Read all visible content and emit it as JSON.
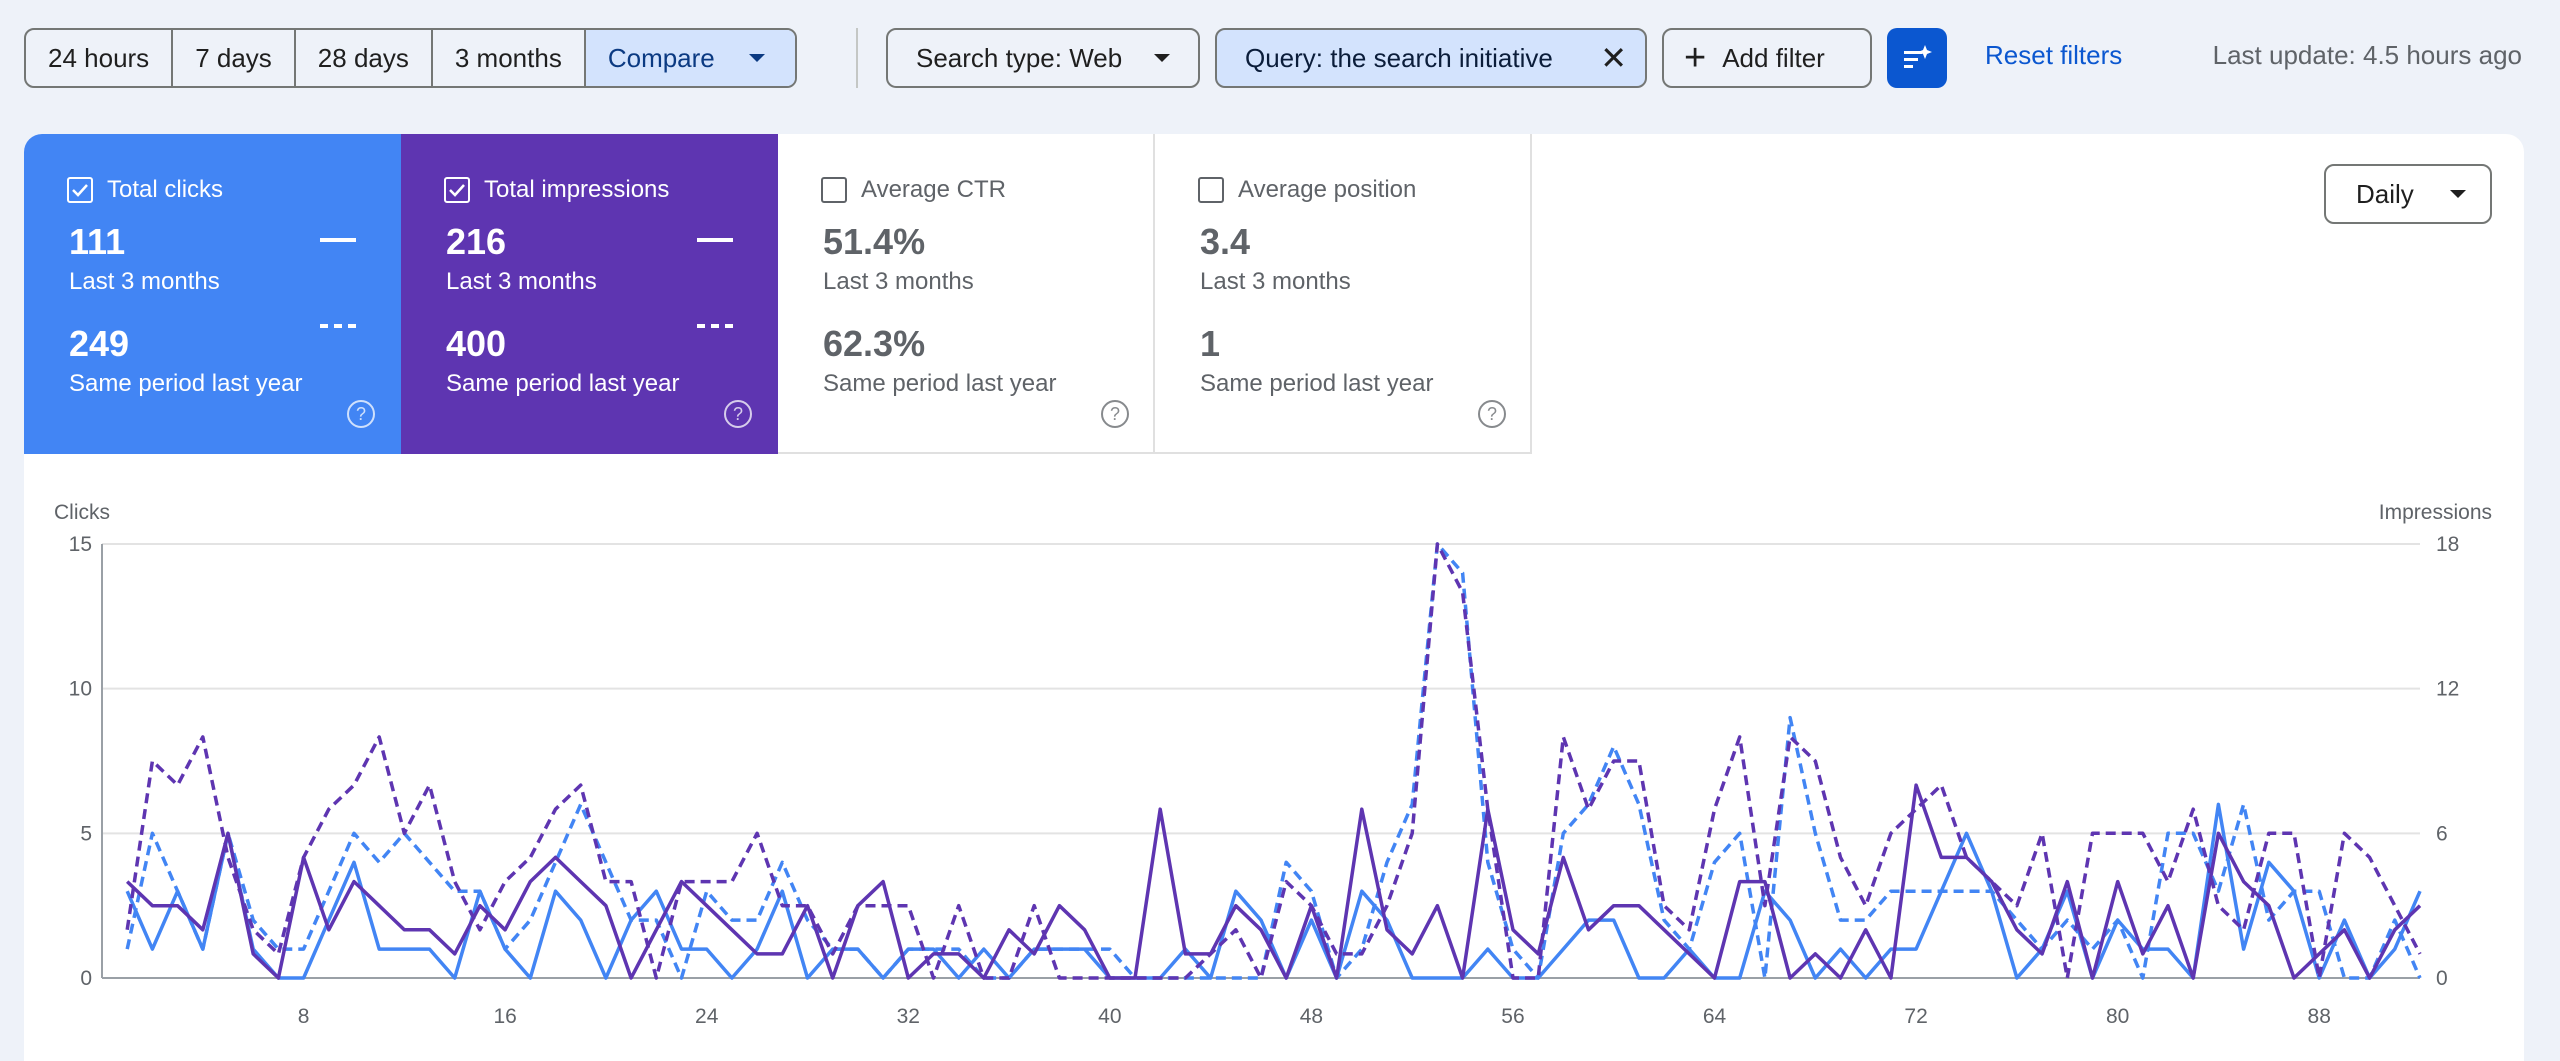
{
  "toolbar": {
    "ranges": [
      "24 hours",
      "7 days",
      "28 days",
      "3 months"
    ],
    "compare_label": "Compare",
    "search_type_label": "Search type: Web",
    "query_label": "Query: the search initiative",
    "add_filter_label": "Add filter",
    "reset_label": "Reset filters",
    "last_update": "Last update: 4.5 hours ago"
  },
  "metrics": {
    "clicks": {
      "label": "Total clicks",
      "value": "111",
      "period": "Last 3 months",
      "compare_value": "249",
      "compare_period": "Same period last year",
      "checked": true,
      "color": "#4285f4"
    },
    "impressions": {
      "label": "Total impressions",
      "value": "216",
      "period": "Last 3 months",
      "compare_value": "400",
      "compare_period": "Same period last year",
      "checked": true,
      "color": "#5e35b1"
    },
    "ctr": {
      "label": "Average CTR",
      "value": "51.4%",
      "period": "Last 3 months",
      "compare_value": "62.3%",
      "compare_period": "Same period last year",
      "checked": false
    },
    "position": {
      "label": "Average position",
      "value": "3.4",
      "period": "Last 3 months",
      "compare_value": "1",
      "compare_period": "Same period last year",
      "checked": false
    }
  },
  "granularity": "Daily",
  "help_glyph": "?",
  "chart_data": {
    "type": "line",
    "left_axis_label": "Clicks",
    "right_axis_label": "Impressions",
    "left_ylim": [
      0,
      15
    ],
    "right_ylim": [
      0,
      18
    ],
    "left_ticks": [
      "0",
      "5",
      "10",
      "15"
    ],
    "right_ticks": [
      "0",
      "6",
      "12",
      "18"
    ],
    "x_ticks": [
      "8",
      "16",
      "24",
      "32",
      "40",
      "48",
      "56",
      "64",
      "72",
      "80",
      "88"
    ],
    "x_range": [
      0,
      92
    ],
    "grid": true,
    "series": [
      {
        "axis": "left",
        "style": "solid",
        "color": "#4285f4",
        "values": [
          3,
          1,
          3,
          1,
          5,
          1,
          0,
          0,
          2,
          4,
          1,
          1,
          1,
          0,
          3,
          1,
          0,
          3,
          2,
          0,
          2,
          3,
          1,
          1,
          0,
          1,
          3,
          0,
          1,
          1,
          0,
          1,
          1,
          0,
          1,
          0,
          1,
          1,
          1,
          0,
          0,
          0,
          1,
          0,
          3,
          2,
          0,
          2,
          0,
          3,
          2,
          0,
          0,
          0,
          1,
          0,
          0,
          1,
          2,
          2,
          0,
          0,
          1,
          0,
          0,
          3,
          2,
          0,
          1,
          0,
          1,
          1,
          3,
          5,
          3,
          0,
          1,
          3,
          0,
          2,
          1,
          1,
          0,
          6,
          1,
          4,
          3,
          0,
          2,
          0,
          1,
          3
        ]
      },
      {
        "axis": "left",
        "style": "dashed",
        "color": "#4285f4",
        "values": [
          1,
          5,
          3,
          1,
          5,
          2,
          1,
          1,
          3,
          5,
          4,
          5,
          4,
          3,
          3,
          1,
          2,
          4,
          6,
          4,
          2,
          2,
          0,
          3,
          2,
          2,
          4,
          2,
          1,
          1,
          0,
          1,
          1,
          1,
          0,
          0,
          1,
          1,
          1,
          1,
          0,
          0,
          0,
          0,
          0,
          0,
          4,
          3,
          0,
          1,
          4,
          6,
          15,
          14,
          4,
          1,
          0,
          5,
          6,
          8,
          6,
          2,
          1,
          4,
          5,
          0,
          9,
          5,
          2,
          2,
          3,
          3,
          3,
          3,
          3,
          2,
          1,
          2,
          1,
          2,
          0,
          5,
          5,
          3,
          6,
          2,
          3,
          3,
          0,
          0,
          2,
          0
        ]
      },
      {
        "axis": "right",
        "style": "solid",
        "color": "#5e35b1",
        "values": [
          4,
          3,
          3,
          2,
          6,
          1,
          0,
          5,
          2,
          4,
          3,
          2,
          2,
          1,
          3,
          2,
          4,
          5,
          4,
          3,
          0,
          2,
          4,
          3,
          2,
          1,
          1,
          3,
          0,
          3,
          4,
          0,
          1,
          1,
          0,
          2,
          1,
          3,
          2,
          0,
          0,
          7,
          1,
          1,
          3,
          2,
          0,
          3,
          0,
          7,
          2,
          1,
          3,
          0,
          7,
          2,
          1,
          5,
          2,
          3,
          3,
          2,
          1,
          0,
          4,
          4,
          0,
          1,
          0,
          2,
          0,
          8,
          5,
          5,
          4,
          2,
          1,
          4,
          0,
          4,
          1,
          3,
          0,
          6,
          4,
          3,
          0,
          1,
          2,
          0,
          2,
          3
        ]
      },
      {
        "axis": "right",
        "style": "dashed",
        "color": "#5e35b1",
        "values": [
          2,
          9,
          8,
          10,
          5,
          2,
          1,
          5,
          7,
          8,
          10,
          6,
          8,
          4,
          2,
          4,
          5,
          7,
          8,
          4,
          4,
          0,
          4,
          4,
          4,
          6,
          3,
          3,
          1,
          3,
          3,
          3,
          0,
          3,
          0,
          0,
          3,
          0,
          0,
          0,
          0,
          0,
          0,
          1,
          2,
          0,
          4,
          3,
          1,
          1,
          3,
          6,
          18,
          16,
          7,
          0,
          0,
          10,
          7,
          9,
          9,
          3,
          2,
          7,
          10,
          3,
          10,
          9,
          5,
          3,
          6,
          7,
          8,
          5,
          4,
          3,
          6,
          0,
          6,
          6,
          6,
          4,
          7,
          3,
          2,
          6,
          6,
          0,
          6,
          5,
          3,
          1
        ]
      }
    ]
  }
}
